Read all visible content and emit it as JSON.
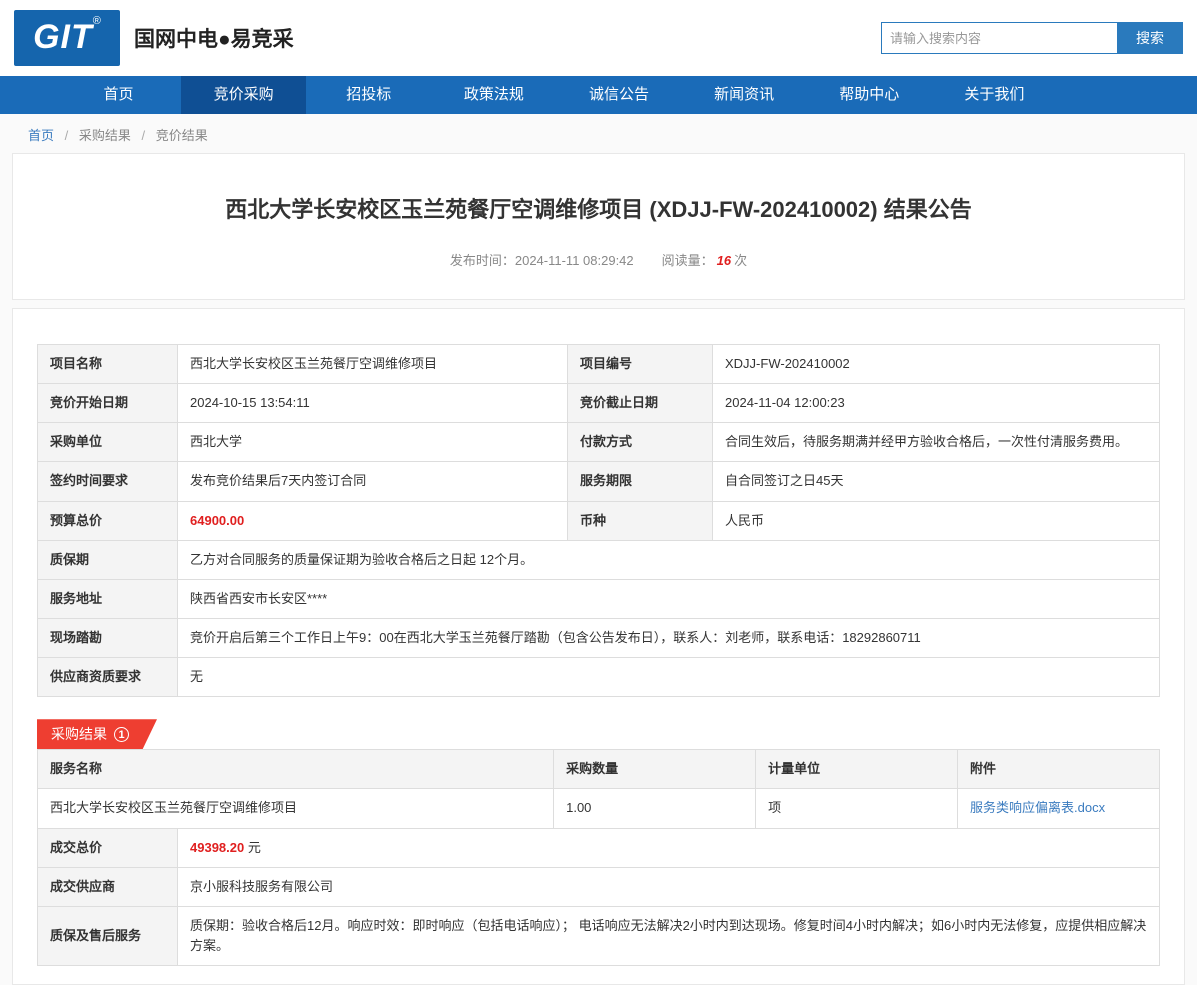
{
  "header": {
    "logo_text": "GIT",
    "logo_reg": "®",
    "site_name": "国网中电●易竞采",
    "search": {
      "placeholder": "请输入搜索内容",
      "button": "搜索"
    }
  },
  "nav": {
    "items": [
      "首页",
      "竞价采购",
      "招投标",
      "政策法规",
      "诚信公告",
      "新闻资讯",
      "帮助中心",
      "关于我们"
    ],
    "active_item": "竞价采购"
  },
  "breadcrumb": {
    "items": [
      "首页",
      "采购结果",
      "竞价结果"
    ],
    "separator": "/"
  },
  "article": {
    "title": "西北大学长安校区玉兰苑餐厅空调维修项目 (XDJJ-FW-202410002) 结果公告",
    "publish_label": "发布时间：",
    "publish_time": "2024-11-11 08:29:42",
    "views_label": "阅读量：",
    "views_count": "16",
    "views_unit": "次"
  },
  "details": {
    "rows4": [
      [
        "项目名称",
        "西北大学长安校区玉兰苑餐厅空调维修项目",
        "项目编号",
        "XDJJ-FW-202410002"
      ],
      [
        "竞价开始日期",
        "2024-10-15 13:54:11",
        "竞价截止日期",
        "2024-11-04 12:00:23"
      ],
      [
        "采购单位",
        "西北大学",
        "付款方式",
        "合同生效后，待服务期满并经甲方验收合格后，一次性付清服务费用。"
      ],
      [
        "签约时间要求",
        "发布竞价结果后7天内签订合同",
        "服务期限",
        "自合同签订之日45天"
      ],
      [
        "预算总价",
        "64900.00",
        "币种",
        "人民币"
      ]
    ],
    "rows2": [
      [
        "质保期",
        "乙方对合同服务的质量保证期为验收合格后之日起 12个月。"
      ],
      [
        "服务地址",
        "陕西省西安市长安区****"
      ],
      [
        "现场踏勘",
        "竞价开启后第三个工作日上午9：00在西北大学玉兰苑餐厅踏勘（包含公告发布日），联系人：刘老师，联系电话：18292860711"
      ],
      [
        "供应商资质要求",
        "无"
      ]
    ]
  },
  "result": {
    "ribbon_label": "采购结果",
    "ribbon_badge": "1",
    "headers": [
      "服务名称",
      "采购数量",
      "计量单位",
      "附件"
    ],
    "row": {
      "service_name": "西北大学长安校区玉兰苑餐厅空调维修项目",
      "quantity": "1.00",
      "unit": "项",
      "attachment": "服务类响应偏离表.docx"
    },
    "total_label": "成交总价",
    "total_value": "49398.20",
    "total_unit": "元",
    "supplier_label": "成交供应商",
    "supplier_value": "京小服科技服务有限公司",
    "warranty_label": "质保及售后服务",
    "warranty_value": "质保期：验收合格后12月。响应时效：即时响应（包括电话响应）； 电话响应无法解决2小时内到达现场。修复时间4小时内解决；如6小时内无法修复，应提供相应解决方案。"
  }
}
